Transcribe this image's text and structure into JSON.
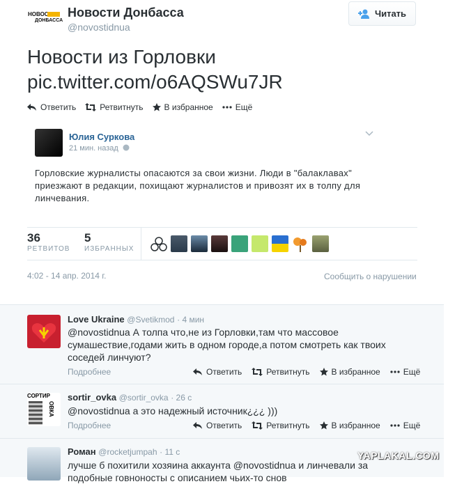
{
  "header": {
    "logo_line1": "НОВОСТИ",
    "logo_line2": "ДОНБАССА",
    "name": "Новости Донбасса",
    "handle": "@novostidnua",
    "follow_label": "Читать"
  },
  "tweet": {
    "line1": "Новости из Горловки",
    "line2": "pic.twitter.com/o6AQSWu7JR"
  },
  "actions": {
    "reply": "Ответить",
    "retweet": "Ретвитнуть",
    "favorite": "В избранное",
    "more": "Ещё"
  },
  "quoted": {
    "name": "Юлия Суркова",
    "time": "21 мин. назад",
    "text": "Горловские журналисты опасаются за свои жизни. Люди в \"балаклавах\" приезжают в редакции, похищают журналистов и привозят их в толпу для линчевания."
  },
  "stats": {
    "retweets_num": "36",
    "retweets_label": "РЕТВИТОВ",
    "favorites_num": "5",
    "favorites_label": "ИЗБРАННЫХ"
  },
  "footer": {
    "date": "4:02 - 14 апр. 2014 г.",
    "report": "Сообщить о нарушении"
  },
  "replies": [
    {
      "name": "Love Ukraine",
      "handle": "@Svetikmod",
      "time": "· 4 мин",
      "text": "@novostidnua А толпа что,не из Горловки,там что массовое сумашествие,годами жить в одном городе,а потом смотреть как твоих соседей линчуют?",
      "more": "Подробнее"
    },
    {
      "name": "sortir_ovka",
      "handle": "@sortir_ovka",
      "time": "· 26 с",
      "text": "@novostidnua а это надежный источник¿¿¿ )))",
      "more": "Подробнее",
      "avatar_text1": "СОРТИР",
      "avatar_text2": "ОВКА"
    },
    {
      "name": "Роман",
      "handle": "@rocketjumpah",
      "time": "· 11 с",
      "text": "лучше б похитили хозяина  аккаунта @novostidnua и линчевали за подобные говноносты с описанием чьих-то снов"
    }
  ],
  "watermark": "YAPLAKAL.COM"
}
